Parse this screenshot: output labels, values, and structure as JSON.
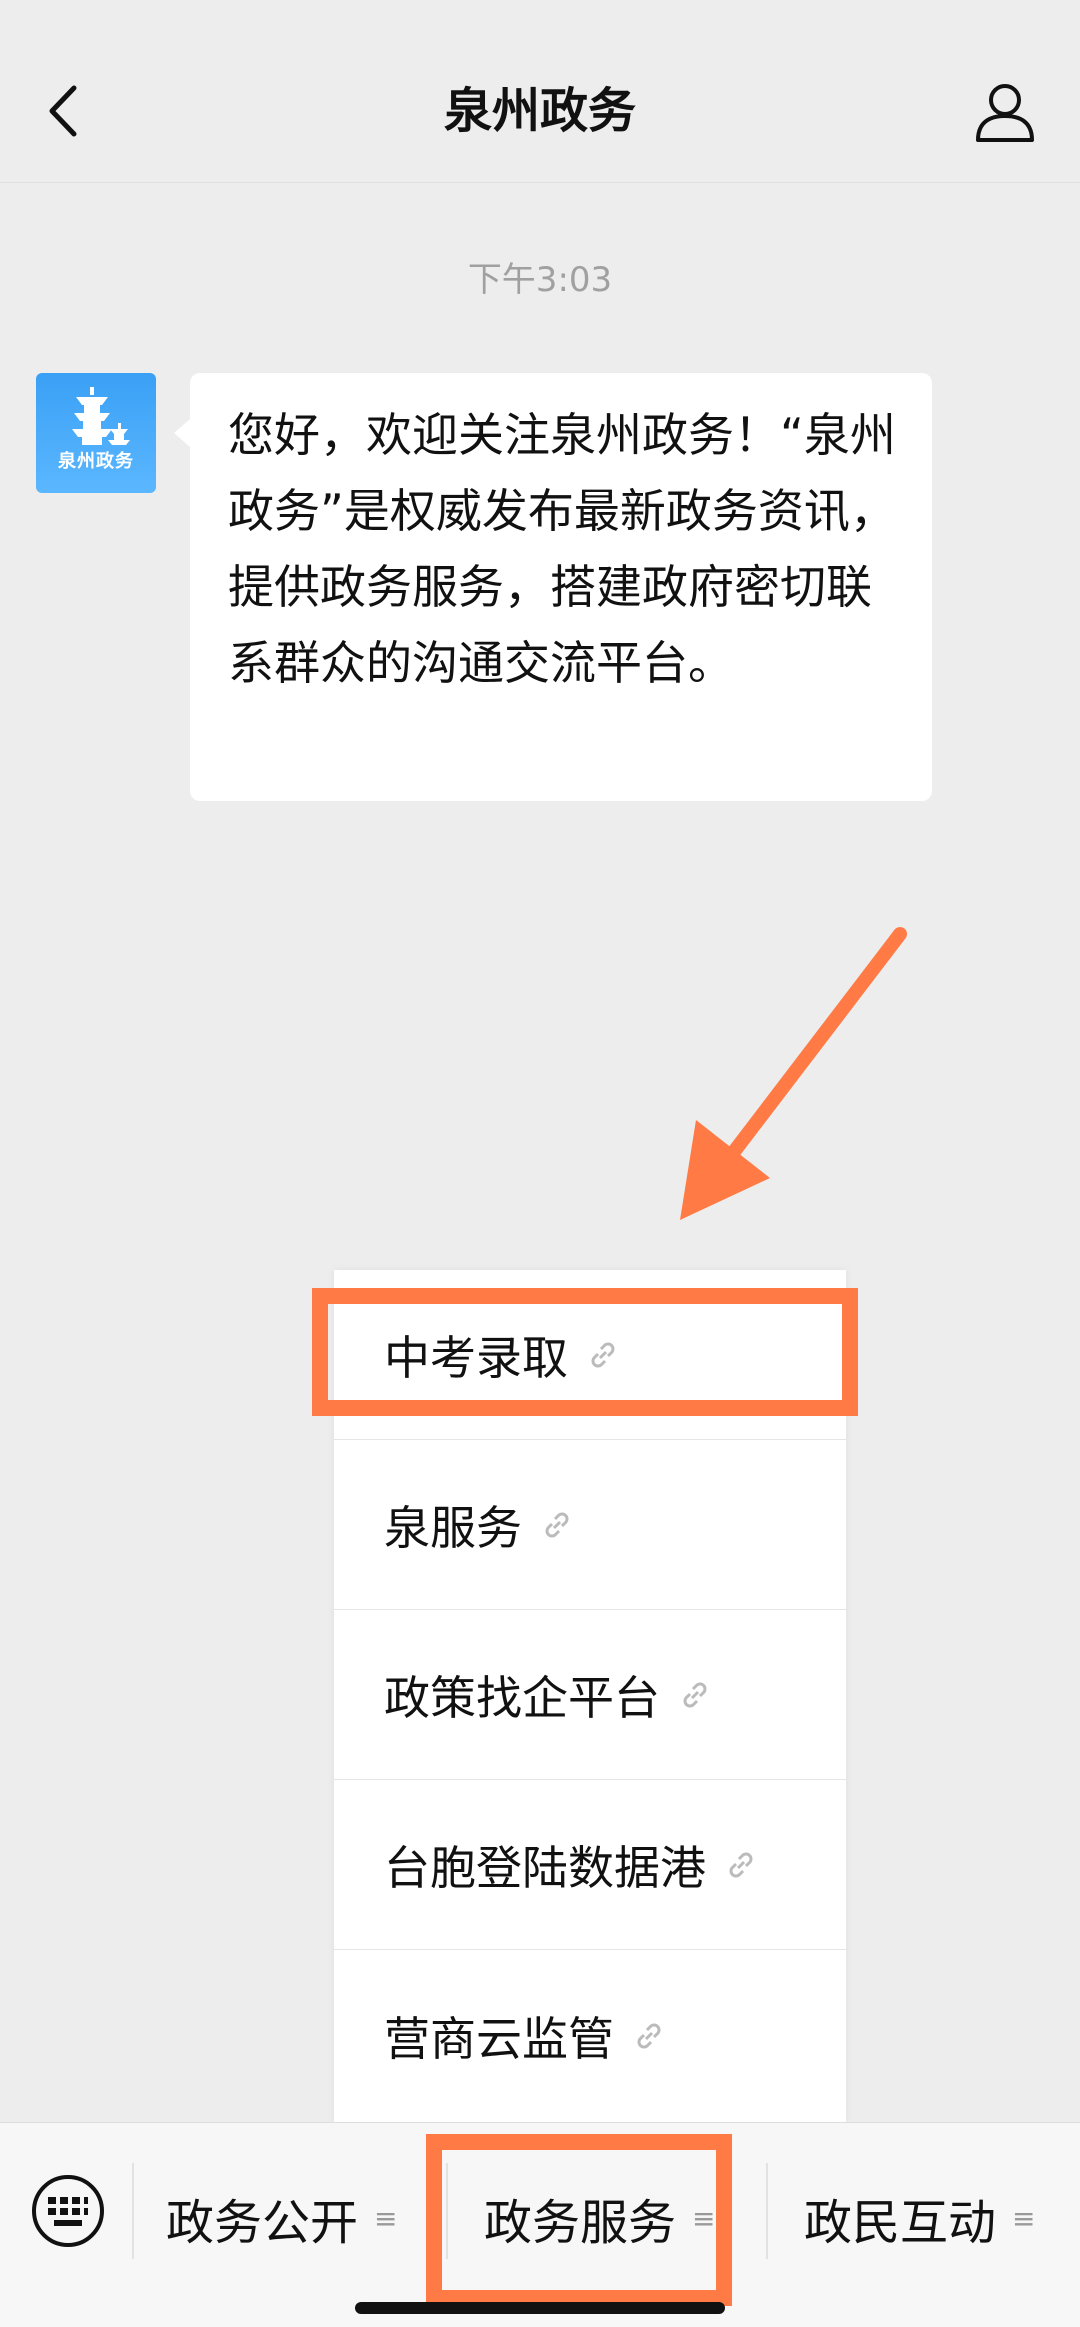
{
  "header": {
    "title": "泉州政务",
    "icons": {
      "back": "chevron-left-icon",
      "profile": "user-icon"
    }
  },
  "chat": {
    "time": "下午3:03",
    "avatar_name": "泉州政务",
    "message": "您好，欢迎关注泉州政务！“泉州政务”是权威发布最新政务资讯，提供政务服务，搭建政府密切联系群众的沟通交流平台。"
  },
  "menu": {
    "items": [
      {
        "label": "中考录取"
      },
      {
        "label": "泉服务"
      },
      {
        "label": "政策找企平台"
      },
      {
        "label": "台胞登陆数据港"
      },
      {
        "label": "营商云监管"
      }
    ]
  },
  "bottom_bar": {
    "tabs": [
      {
        "label": "政务公开"
      },
      {
        "label": "政务服务"
      },
      {
        "label": "政民互动"
      }
    ]
  },
  "colors": {
    "highlight": "#ff7a45",
    "avatar": "#3aa0f5",
    "background": "#ededed"
  }
}
